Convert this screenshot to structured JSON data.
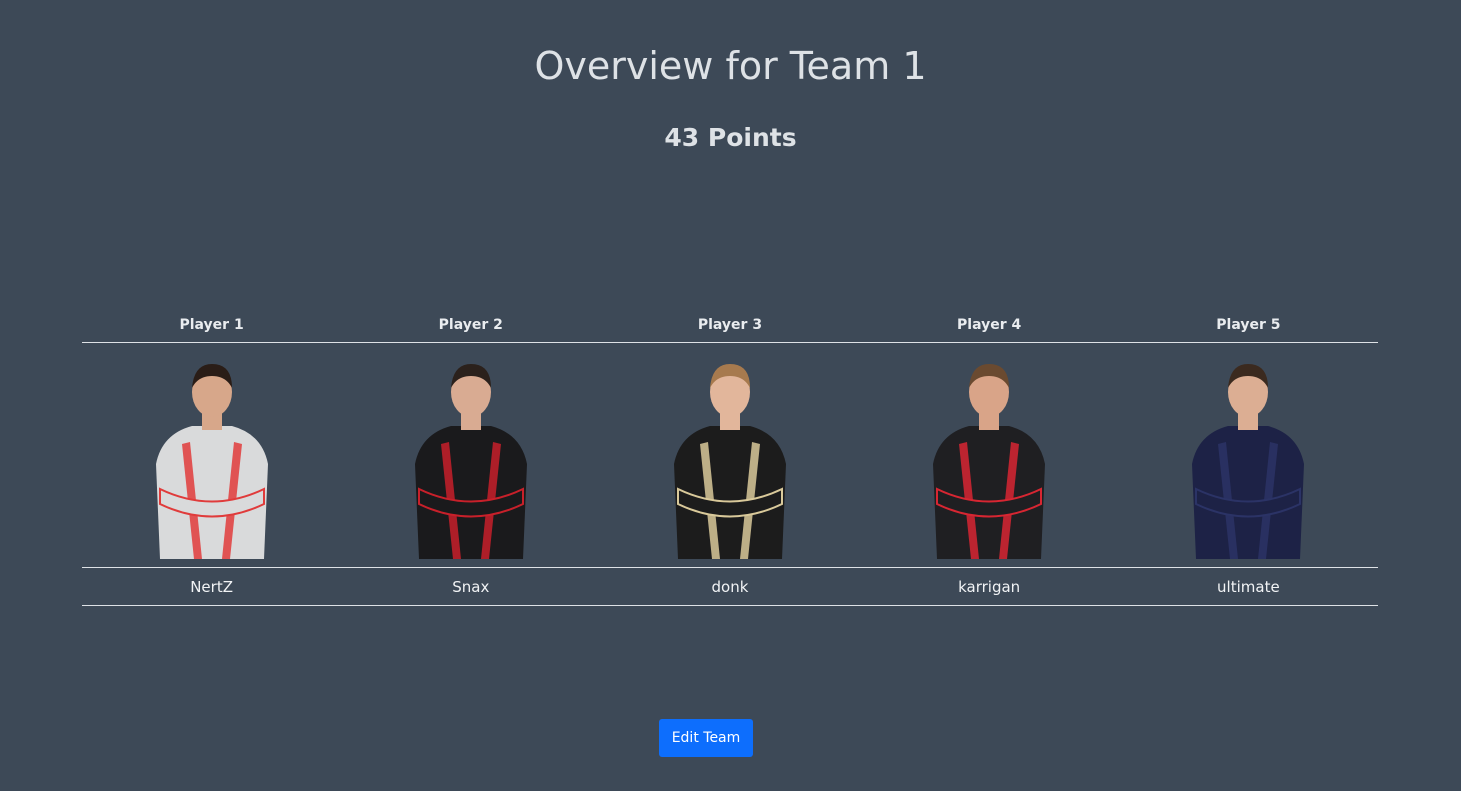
{
  "header": {
    "title": "Overview for Team 1",
    "points": "43 Points"
  },
  "table": {
    "headers": [
      "Player 1",
      "Player 2",
      "Player 3",
      "Player 4",
      "Player 5"
    ],
    "players": [
      {
        "name": "NertZ",
        "jersey_primary": "#d9dadb",
        "jersey_accent": "#e03b3b",
        "hair": "#2a1d17",
        "skin": "#d7a78a"
      },
      {
        "name": "Snax",
        "jersey_primary": "#1a1a1c",
        "jersey_accent": "#c8202a",
        "hair": "#2b211c",
        "skin": "#d9ab92"
      },
      {
        "name": "donk",
        "jersey_primary": "#1c1c1c",
        "jersey_accent": "#d9c99a",
        "hair": "#a77a4e",
        "skin": "#e2b69b"
      },
      {
        "name": "karrigan",
        "jersey_primary": "#1f1f22",
        "jersey_accent": "#d82632",
        "hair": "#6a4a30",
        "skin": "#d9a488"
      },
      {
        "name": "ultimate",
        "jersey_primary": "#1d2246",
        "jersey_accent": "#2b3366",
        "hair": "#3b2a1f",
        "skin": "#dcae93"
      }
    ]
  },
  "actions": {
    "edit_label": "Edit Team"
  },
  "colors": {
    "background": "#3d4957",
    "accent": "#0d6efd"
  }
}
